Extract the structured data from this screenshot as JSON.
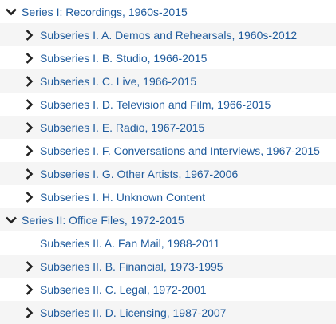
{
  "tree": {
    "series": [
      {
        "label": "Series I: Recordings, 1960s-2015",
        "expanded": true,
        "icon": "chevron-down-icon",
        "children": [
          {
            "label": "Subseries I. A. Demos and Rehearsals, 1960s-2012",
            "has_children": true,
            "icon": "chevron-right-icon"
          },
          {
            "label": "Subseries I. B. Studio, 1966-2015",
            "has_children": true,
            "icon": "chevron-right-icon"
          },
          {
            "label": "Subseries I. C. Live, 1966-2015",
            "has_children": true,
            "icon": "chevron-right-icon"
          },
          {
            "label": "Subseries I. D. Television and Film, 1966-2015",
            "has_children": true,
            "icon": "chevron-right-icon"
          },
          {
            "label": "Subseries I. E. Radio, 1967-2015",
            "has_children": true,
            "icon": "chevron-right-icon"
          },
          {
            "label": "Subseries I. F. Conversations and Interviews, 1967-2015",
            "has_children": true,
            "icon": "chevron-right-icon"
          },
          {
            "label": "Subseries I. G. Other Artists, 1967-2006",
            "has_children": true,
            "icon": "chevron-right-icon"
          },
          {
            "label": "Subseries I. H. Unknown Content",
            "has_children": true,
            "icon": "chevron-right-icon"
          }
        ]
      },
      {
        "label": "Series II: Office Files, 1972-2015",
        "expanded": true,
        "icon": "chevron-down-icon",
        "children": [
          {
            "label": "Subseries II. A. Fan Mail, 1988-2011",
            "has_children": false,
            "icon": ""
          },
          {
            "label": "Subseries II. B. Financial, 1973-1995",
            "has_children": true,
            "icon": "chevron-right-icon"
          },
          {
            "label": "Subseries II. C. Legal, 1972-2001",
            "has_children": true,
            "icon": "chevron-right-icon"
          },
          {
            "label": "Subseries II. D. Licensing, 1987-2007",
            "has_children": true,
            "icon": "chevron-right-icon"
          }
        ]
      }
    ]
  },
  "colors": {
    "link": "#1e5a9c",
    "row_alt": "#f5f5f5",
    "icon": "#222222"
  }
}
